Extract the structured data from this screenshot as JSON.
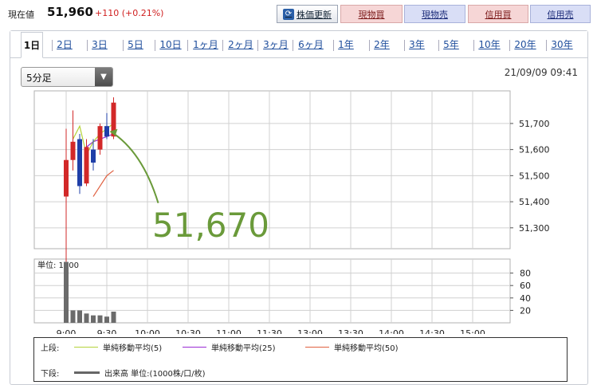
{
  "quote": {
    "label": "現在値",
    "price": "51,960",
    "change": "+110 (+0.21%)"
  },
  "buttons": {
    "refresh": "株価更新",
    "spot_buy": "現物買",
    "spot_sell": "現物売",
    "margin_buy": "信用買",
    "margin_sell": "信用売"
  },
  "tabs": [
    "1日",
    "2日",
    "3日",
    "5日",
    "10日",
    "1ヶ月",
    "2ヶ月",
    "3ヶ月",
    "6ヶ月",
    "1年",
    "2年",
    "3年",
    "5年",
    "10年",
    "20年",
    "30年"
  ],
  "interval_select": {
    "value": "5分足"
  },
  "timestamp": "21/09/09 09:41",
  "legend": {
    "upper_prefix": "上段:",
    "lower_prefix": "下段:",
    "ma5": "単純移動平均(5)",
    "ma25": "単純移動平均(25)",
    "ma50": "単純移動平均(50)",
    "volume": "出来高 単位:(1000株/口/枚)"
  },
  "colors": {
    "up_candle": "#d22828",
    "down_candle": "#1f3fa8",
    "ma5": "#b4d33a",
    "ma25": "#9b2bd4",
    "ma50": "#e06040",
    "volume_bar": "#6b6b6b",
    "callout": "#6a9a3a",
    "tab_link": "#1f4e9c"
  },
  "chart_data": [
    {
      "type": "candlestick",
      "x_categories": [
        "9:00",
        "9:05",
        "9:10",
        "9:15",
        "9:20",
        "9:25",
        "9:30",
        "9:35",
        "9:40"
      ],
      "x_tick_labels": [
        "9:00",
        "9:30",
        "10:00",
        "10:30",
        "11:00",
        "11:30",
        "13:00",
        "13:30",
        "14:00",
        "14:30",
        "15:00"
      ],
      "y_ticks": [
        51700,
        51600,
        51500,
        51400,
        51300
      ],
      "y_tick_labels": [
        "51,700",
        "51,600",
        "51,500",
        "51,400",
        "51,300"
      ],
      "ylim": [
        51220,
        51825
      ],
      "candles": [
        {
          "time": "9:00",
          "open": 51420,
          "high": 51680,
          "low": 51170,
          "close": 51560
        },
        {
          "time": "9:05",
          "open": 51560,
          "high": 51750,
          "low": 51520,
          "close": 51630
        },
        {
          "time": "9:10",
          "open": 51640,
          "high": 51660,
          "low": 51430,
          "close": 51460
        },
        {
          "time": "9:15",
          "open": 51470,
          "high": 51640,
          "low": 51460,
          "close": 51610
        },
        {
          "time": "9:20",
          "open": 51600,
          "high": 51640,
          "low": 51520,
          "close": 51550
        },
        {
          "time": "9:25",
          "open": 51600,
          "high": 51700,
          "low": 51580,
          "close": 51690
        },
        {
          "time": "9:30",
          "open": 51690,
          "high": 51740,
          "low": 51640,
          "close": 51650
        },
        {
          "time": "9:35",
          "open": 51650,
          "high": 51800,
          "low": 51640,
          "close": 51780
        }
      ],
      "ma5": [
        51640,
        51690,
        51580,
        51630,
        51660,
        51680,
        51700
      ],
      "ma25": [
        51610,
        51630,
        51640,
        51650,
        51660
      ],
      "ma50": [
        51420,
        51460,
        51500,
        51520
      ],
      "callout": "51,670",
      "callout_value": 51670
    },
    {
      "type": "bar",
      "title": "単位: 1000",
      "categories": [
        "9:00",
        "9:05",
        "9:10",
        "9:15",
        "9:20",
        "9:25",
        "9:30",
        "9:35",
        "9:40"
      ],
      "values": [
        98,
        20,
        20,
        15,
        12,
        12,
        10,
        18,
        0
      ],
      "y_ticks": [
        80,
        60,
        40,
        20
      ],
      "ylim": [
        0,
        100
      ]
    }
  ]
}
